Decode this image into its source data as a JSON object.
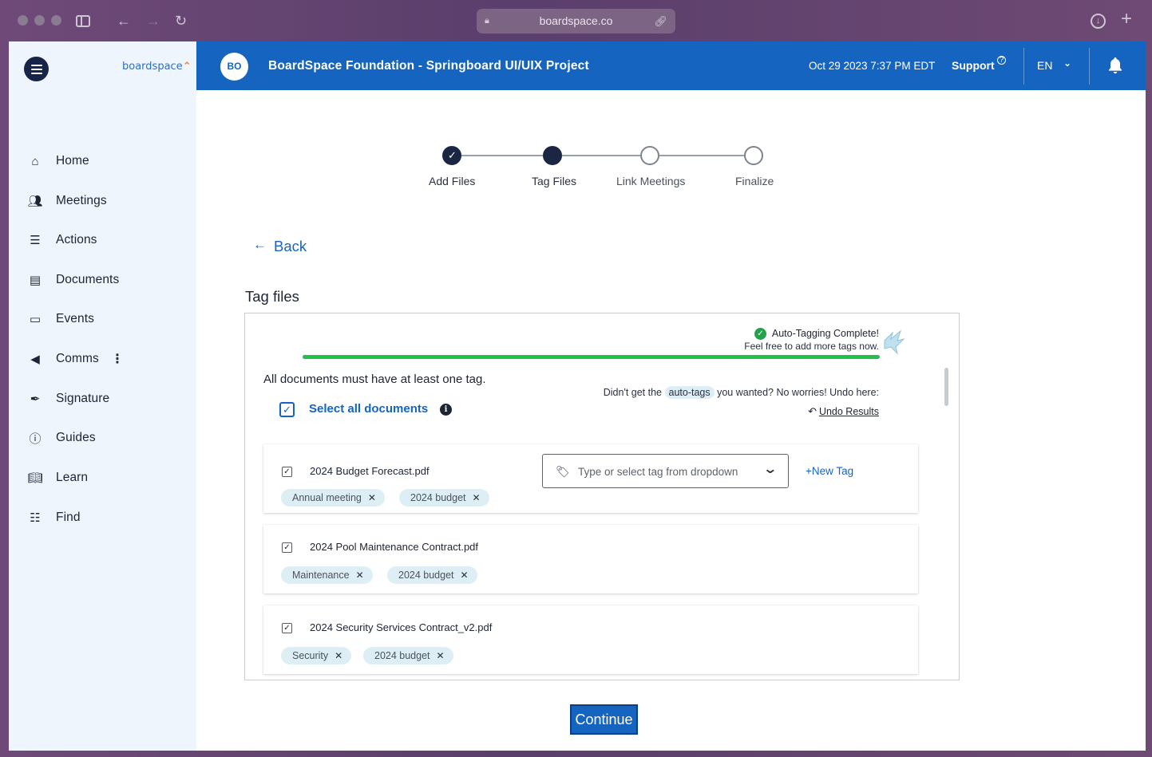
{
  "browser": {
    "url": "boardspace.co"
  },
  "sidebar": {
    "brand": "boardspace",
    "items": [
      {
        "label": "Home",
        "icon": "home-icon"
      },
      {
        "label": "Meetings",
        "icon": "meetings-icon"
      },
      {
        "label": "Actions",
        "icon": "list-icon"
      },
      {
        "label": "Documents",
        "icon": "document-icon"
      },
      {
        "label": "Events",
        "icon": "calendar-icon"
      },
      {
        "label": "Comms",
        "icon": "megaphone-icon"
      },
      {
        "label": "Signature",
        "icon": "pen-icon"
      },
      {
        "label": "Guides",
        "icon": "info-icon"
      },
      {
        "label": "Learn",
        "icon": "book-icon"
      },
      {
        "label": "Find",
        "icon": "find-icon"
      }
    ]
  },
  "header": {
    "avatar_initials": "BO",
    "title": "BoardSpace Foundation - Springboard UI/UIX Project",
    "datetime": "Oct 29 2023 7:37 PM EDT",
    "support_label": "Support",
    "language": "EN"
  },
  "stepper": {
    "steps": [
      {
        "label": "Add Files",
        "state": "done"
      },
      {
        "label": "Tag Files",
        "state": "active"
      },
      {
        "label": "Link Meetings",
        "state": "pending"
      },
      {
        "label": "Finalize",
        "state": "pending"
      }
    ]
  },
  "main": {
    "back_label": "Back",
    "section_title": "Tag files",
    "auto_tag_title": "Auto-Tagging Complete!",
    "auto_tag_subtitle": "Feel free to add more tags now.",
    "progress": 1.0,
    "rule_text": "All documents must have at least one tag.",
    "select_all_label": "Select all documents",
    "undo_prefix": "Didn't get the",
    "undo_chip": "auto-tags",
    "undo_suffix": "you wanted? No worries! Undo here:",
    "undo_link": "Undo Results",
    "tag_placeholder": "Type or select tag from dropdown",
    "new_tag_label": "+New Tag",
    "continue_label": "Continue",
    "files": [
      {
        "name": "2024 Budget Forecast.pdf",
        "checked": true,
        "tags": [
          "Annual meeting",
          "2024 budget"
        ]
      },
      {
        "name": "2024 Pool Maintenance Contract.pdf",
        "checked": true,
        "tags": [
          "Maintenance",
          "2024 budget"
        ]
      },
      {
        "name": "2024 Security Services Contract_v2.pdf",
        "checked": true,
        "tags": [
          "Security",
          "2024 budget"
        ]
      }
    ]
  },
  "colors": {
    "primary": "#1565c0",
    "sidebar_bg": "#eef5fc",
    "progress": "#22c04e",
    "stepper_active": "#1a2642",
    "tag_chip_bg": "#ddeff5"
  }
}
